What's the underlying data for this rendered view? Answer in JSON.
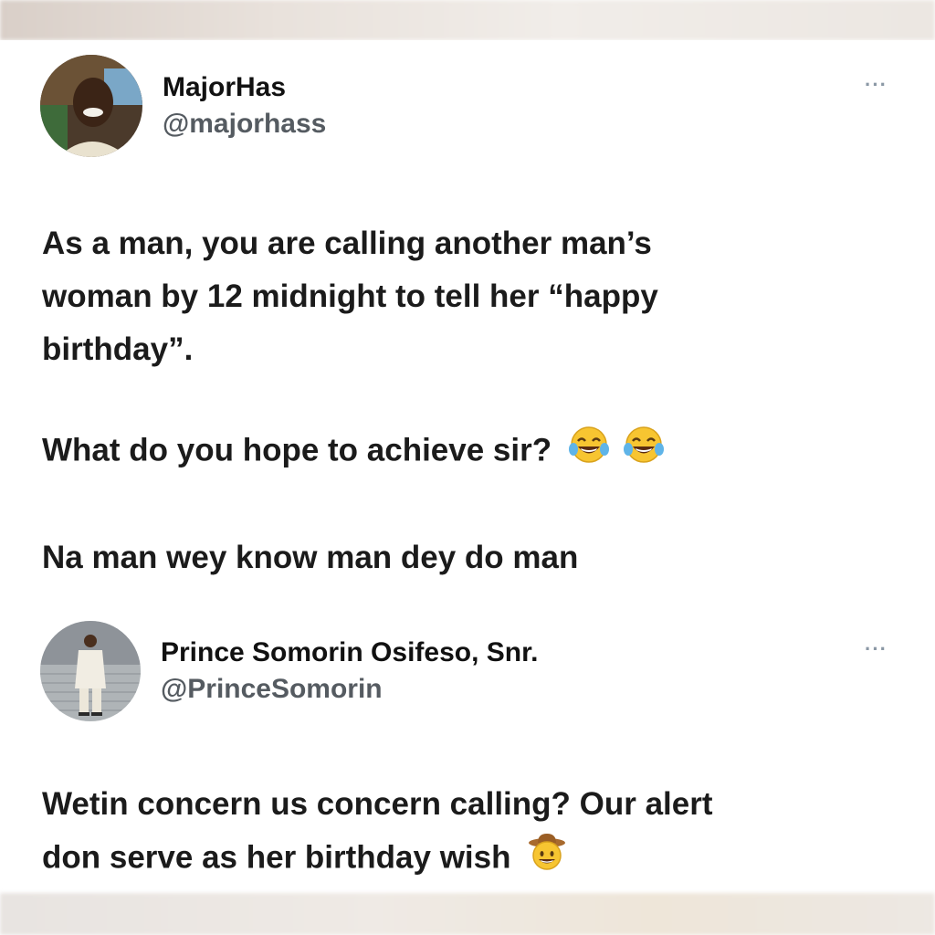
{
  "tweets": [
    {
      "author": {
        "display_name": "MajorHas",
        "handle": "@majorhass",
        "avatar_icon": "profile-photo"
      },
      "more_icon": "ellipsis-icon",
      "more_label": "···",
      "body": {
        "paragraph1_line1": "As a man, you are calling another man’s",
        "paragraph1_line2": "woman by 12 midnight to tell her “happy",
        "paragraph1_line3": "birthday”.",
        "paragraph2": "What do you hope to achieve sir?",
        "paragraph2_emoji": "face-with-tears-of-joy",
        "paragraph3": "Na man wey know man dey do man"
      }
    },
    {
      "author": {
        "display_name": "Prince Somorin Osifeso, Snr.",
        "handle": "@PrinceSomorin",
        "avatar_icon": "profile-photo"
      },
      "more_icon": "ellipsis-icon",
      "more_label": "···",
      "body": {
        "line1": "Wetin concern us concern calling? Our alert",
        "line2": "don serve as her birthday wish",
        "line2_emoji": "cowboy-hat-face"
      }
    }
  ],
  "colors": {
    "text": "#1b1b1b",
    "handle": "#555b61",
    "more": "#8b98a5",
    "background": "#ffffff"
  }
}
